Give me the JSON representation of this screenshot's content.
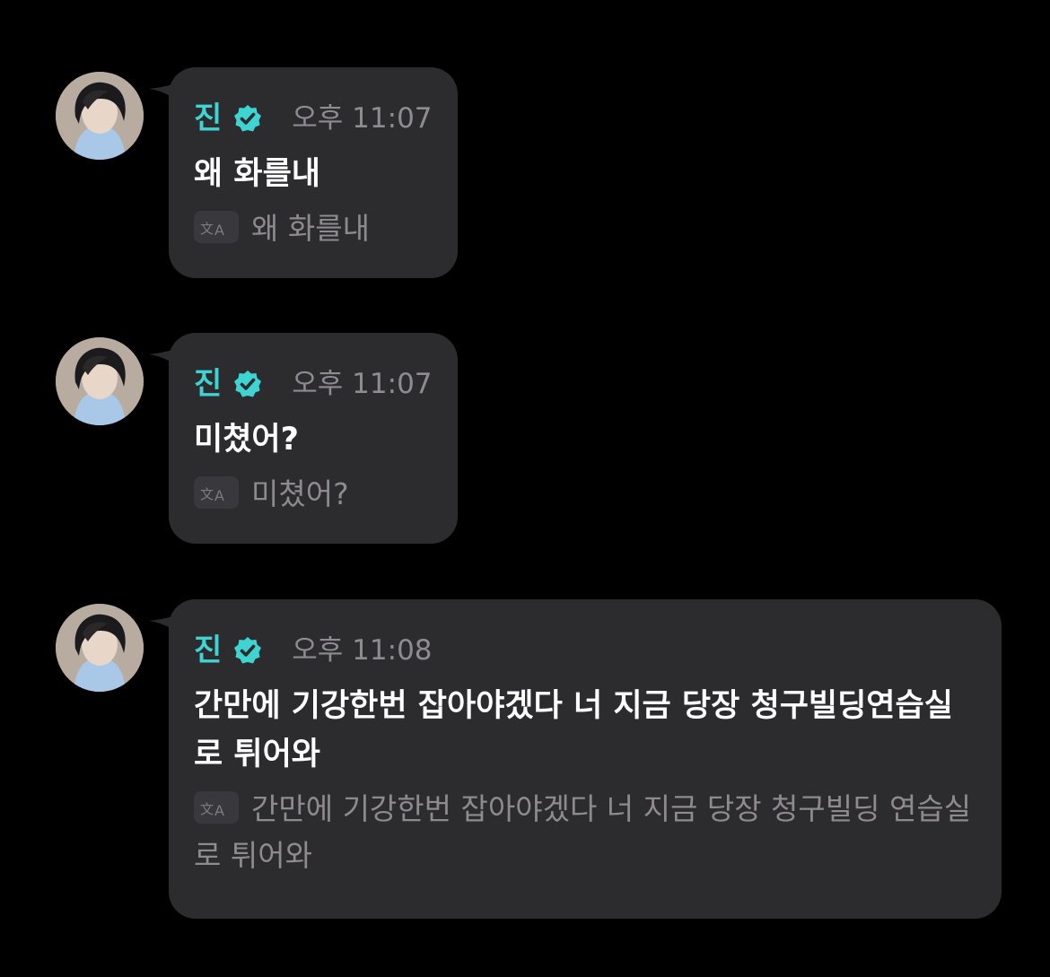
{
  "messages": [
    {
      "sender": "진",
      "time": "오후 11:07",
      "text": "왜 화를내",
      "translation": "왜 화를내"
    },
    {
      "sender": "진",
      "time": "오후 11:07",
      "text": "미쳤어?",
      "translation": "미쳤어?"
    },
    {
      "sender": "진",
      "time": "오후 11:08",
      "text": "간만에 기강한번 잡아야겠다 너 지금 당장 청구빌딩연습실로 튀어와",
      "translation": "간만에 기강한번 잡아야겠다 너 지금 당장 청구빌딩 연습실로 튀어와"
    }
  ],
  "icons": {
    "verified": "verified-badge-icon",
    "translate": "translate-icon"
  },
  "colors": {
    "background": "#000000",
    "bubble": "#2c2b2e",
    "name": "#3fd3d2",
    "time": "#8e8c92",
    "text": "#ffffff",
    "translation": "#8d8b90"
  }
}
